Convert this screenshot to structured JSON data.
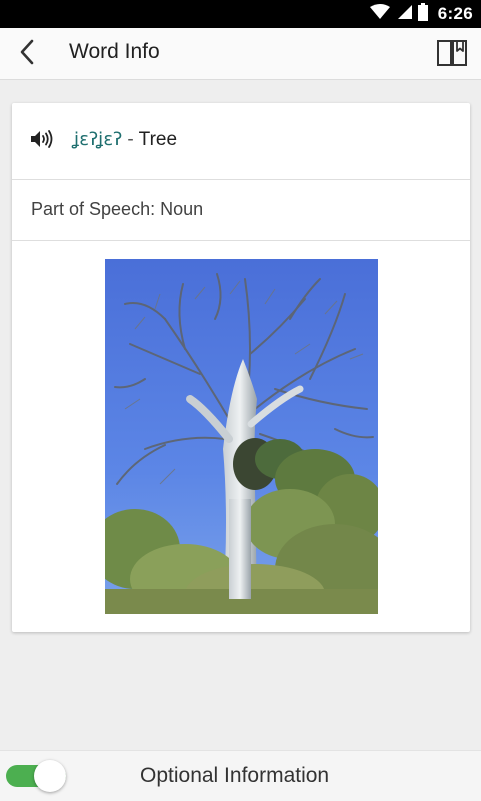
{
  "status_bar": {
    "time": "6:26",
    "icons": [
      "wifi-icon",
      "cell-signal-icon",
      "battery-icon"
    ]
  },
  "app_bar": {
    "title": "Word Info",
    "back_icon": "chevron-left-icon",
    "book_icon": "book-bookmark-icon"
  },
  "word": {
    "native": "ʝɛʔʝɛʔ",
    "separator": "-",
    "english": "Tree",
    "audio_icon": "speaker-icon"
  },
  "part_of_speech": {
    "text": "Part of Speech: Noun"
  },
  "image": {
    "subject": "tree-photo"
  },
  "bottom": {
    "toggle_on": true,
    "label": "Optional Information"
  },
  "colors": {
    "accent": "#4caf50",
    "native_word": "#1f6f6f"
  }
}
